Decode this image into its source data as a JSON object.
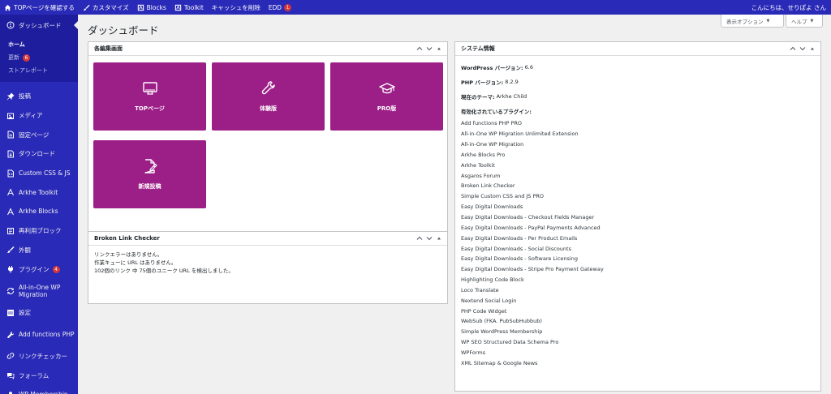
{
  "adminbar": {
    "items": [
      {
        "icon": "home-icon",
        "label": "TOPページを確認する"
      },
      {
        "icon": "brush-icon",
        "label": "カスタマイズ"
      },
      {
        "icon": "blocks-icon",
        "label": "Blocks"
      },
      {
        "icon": "toolkit-icon",
        "label": "Toolkit"
      },
      {
        "icon": "",
        "label": "キャッシュを削除"
      },
      {
        "icon": "",
        "label": "EDD",
        "badge": "1"
      }
    ],
    "greeting": "こんにちは、せりぽよ さん"
  },
  "sidebar": {
    "current": {
      "icon": "dashboard-icon",
      "label": "ダッシュボード"
    },
    "submenu": [
      {
        "label": "ホーム"
      },
      {
        "label": "更新",
        "badge": "6"
      },
      {
        "label": "ストアレポート"
      }
    ],
    "items": [
      {
        "icon": "pin-icon",
        "label": "投稿"
      },
      {
        "icon": "media-icon",
        "label": "メディア"
      },
      {
        "icon": "page-icon",
        "label": "固定ページ"
      },
      {
        "icon": "download-icon",
        "label": "ダウンロード"
      },
      {
        "icon": "code-icon",
        "label": "Custom CSS & JS"
      },
      {
        "icon": "arkhe-icon",
        "label": "Arkhe Toolkit"
      },
      {
        "icon": "arkhe-icon",
        "label": "Arkhe Blocks"
      },
      {
        "icon": "block-icon",
        "label": "再利用ブロック"
      },
      {
        "icon": "brush-icon",
        "label": "外観"
      },
      {
        "icon": "plugin-icon",
        "label": "プラグイン",
        "badge": "4"
      },
      {
        "icon": "migration-icon",
        "label": "All-in-One WP Migration"
      },
      {
        "icon": "settings-icon",
        "label": "設定"
      },
      {
        "icon": "wrench-icon",
        "label": "Add functions PHP"
      },
      {
        "icon": "link-icon",
        "label": "リンクチェッカー"
      },
      {
        "icon": "forum-icon",
        "label": "フォーラム"
      },
      {
        "icon": "membership-icon",
        "label": "WP Membership"
      }
    ]
  },
  "main": {
    "title": "ダッシュボード",
    "screen_options": "表示オプション",
    "help": "ヘルプ"
  },
  "edit_panel": {
    "title": "各編集画面",
    "tiles": [
      {
        "icon": "monitor-icon",
        "label": "TOPページ"
      },
      {
        "icon": "wrench-icon",
        "label": "体験版"
      },
      {
        "icon": "graduation-cap-icon",
        "label": "PRO版"
      },
      {
        "icon": "new-post-icon",
        "label": "新規投稿"
      }
    ]
  },
  "blc_panel": {
    "title": "Broken Link Checker",
    "lines": [
      "リンクエラーはありません。",
      "作業キューに URL はありません。",
      "102個のリンク 中 75個のユニーク URL を検出しました。"
    ]
  },
  "system_panel": {
    "title": "システム情報",
    "wp_label": "WordPress バージョン:",
    "wp_value": "6.6",
    "php_label": "PHP バージョン:",
    "php_value": "8.2.9",
    "theme_label": "現在のテーマ:",
    "theme_value": "Arkhe Child",
    "plugins_label": "有効化されているプラグイン:",
    "plugins": [
      "Add functions PHP PRO",
      "All-in-One WP Migration Unlimited Extension",
      "All-in-One WP Migration",
      "Arkhe Blocks Pro",
      "Arkhe Toolkit",
      "Asgaros Forum",
      "Broken Link Checker",
      "Simple Custom CSS and JS PRO",
      "Easy Digital Downloads",
      "Easy Digital Downloads - Checkout Fields Manager",
      "Easy Digital Downloads - PayPal Payments Advanced",
      "Easy Digital Downloads - Per Product Emails",
      "Easy Digital Downloads - Social Discounts",
      "Easy Digital Downloads - Software Licensing",
      "Easy Digital Downloads - Stripe Pro Payment Gateway",
      "Highlighting Code Block",
      "Loco Translate",
      "Nextend Social Login",
      "PHP Code Widget",
      "WebSub (FKA. PubSubHubbub)",
      "Simple WordPress Membership",
      "WP SEO Structured Data Schema Pro",
      "WPForms",
      "XML Sitemap & Google News"
    ]
  },
  "colors": {
    "sidebar_bg": "#2a2ab8",
    "tile_bg": "#9c1e87",
    "badge": "#d63638"
  }
}
